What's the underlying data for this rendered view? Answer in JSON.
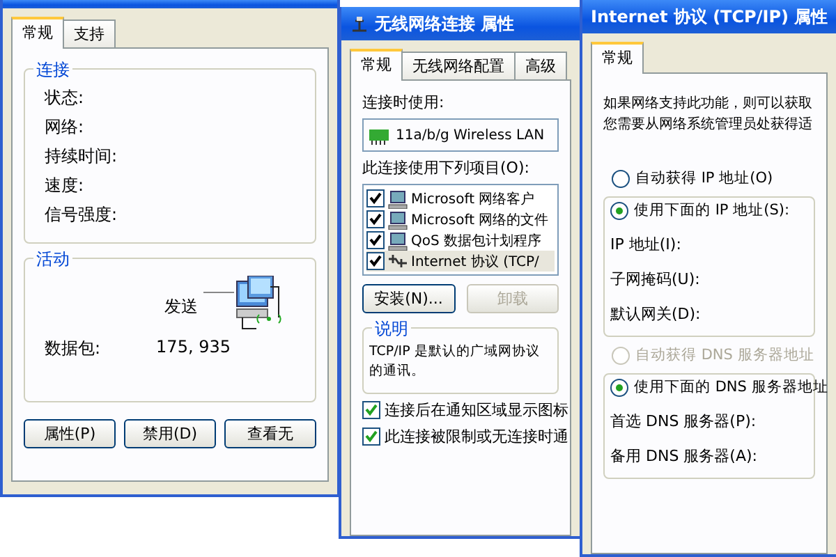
{
  "status_window": {
    "tabs": [
      {
        "label": "常规",
        "selected": true
      },
      {
        "label": "支持",
        "selected": false
      }
    ],
    "connection_group": {
      "title": "连接",
      "labels": [
        "状态:",
        "网络:",
        "持续时间:",
        "速度:",
        "信号强度:"
      ]
    },
    "activity_group": {
      "title": "活动",
      "sent_label": "发送",
      "packets_label": "数据包:",
      "packets_sent": "175, 935"
    },
    "buttons": [
      "属性(P)",
      "禁用(D)",
      "查看无"
    ]
  },
  "properties_window": {
    "title": "无线网络连接 属性",
    "tabs": [
      {
        "label": "常规",
        "selected": true
      },
      {
        "label": "无线网络配置",
        "selected": false
      },
      {
        "label": "高级",
        "selected": false
      }
    ],
    "connect_using_label": "连接时使用:",
    "adapter": "11a/b/g Wireless LAN",
    "items_label": "此连接使用下列项目(O):",
    "items": [
      {
        "label": "Microsoft 网络客户",
        "kind": "computer",
        "checked": true,
        "selected": false
      },
      {
        "label": "Microsoft 网络的文件",
        "kind": "computer",
        "checked": true,
        "selected": false
      },
      {
        "label": "QoS 数据包计划程序",
        "kind": "computer",
        "checked": true,
        "selected": false
      },
      {
        "label": "Internet 协议 (TCP/",
        "kind": "protocol",
        "checked": true,
        "selected": true
      }
    ],
    "buttons": [
      {
        "label": "安装(N)...",
        "disabled": false
      },
      {
        "label": "卸载",
        "disabled": true
      }
    ],
    "description": {
      "title": "说明",
      "lines": [
        "TCP/IP 是默认的广域网协议",
        "的通讯。"
      ]
    },
    "options": [
      {
        "label": "连接后在通知区域显示图标",
        "checked": true
      },
      {
        "label": "此连接被限制或无连接时通",
        "checked": true
      }
    ]
  },
  "tcpip_window": {
    "title": "Internet 协议 (TCP/IP) 属性",
    "tabs": [
      {
        "label": "常规",
        "selected": true
      }
    ],
    "intro_lines": [
      "如果网络支持此功能，则可以获取",
      "您需要从网络系统管理员处获得适"
    ],
    "ip_mode": [
      {
        "label": "自动获得 IP 地址(O)",
        "selected": false,
        "disabled": false
      },
      {
        "label": "使用下面的 IP 地址(S):",
        "selected": true,
        "disabled": false
      }
    ],
    "ip_fields": [
      "IP 地址(I):",
      "子网掩码(U):",
      "默认网关(D):"
    ],
    "dns_mode": [
      {
        "label": "自动获得 DNS 服务器地址",
        "selected": false,
        "disabled": true
      },
      {
        "label": "使用下面的 DNS 服务器地址",
        "selected": true,
        "disabled": false
      }
    ],
    "dns_fields": [
      "首选 DNS 服务器(P):",
      "备用 DNS 服务器(A):"
    ]
  }
}
